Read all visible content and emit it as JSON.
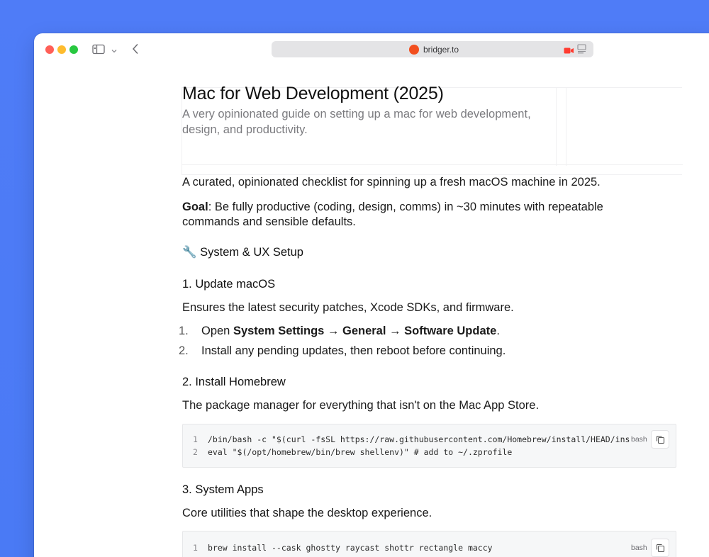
{
  "browser": {
    "url": "bridger.to",
    "favicon_color": "#f24e1e",
    "traffic_colors": [
      "#ff5f57",
      "#febc2e",
      "#28c840"
    ]
  },
  "header": {
    "title": "Mac for Web Development (2025)",
    "subtitle": "A very opinionated guide on setting up a mac for web development, design, and productivity."
  },
  "article": {
    "intro": "A curated, opinionated checklist for spinning up a fresh macOS machine in 2025.",
    "goal_label": "Goal",
    "goal_text": ": Be fully productive (coding, design, comms) in ~30 minutes with repeatable commands and sensible defaults.",
    "section_heading": "🔧 System & UX Setup",
    "steps": [
      {
        "heading": "1. Update macOS",
        "description": "Ensures the latest security patches, Xcode SDKs, and firmware.",
        "list": [
          {
            "num": "1.",
            "prefix": "Open ",
            "b1": "System Settings",
            "a1": " → ",
            "b2": "General",
            "a2": " → ",
            "b3": "Software Update",
            "suffix": "."
          },
          {
            "num": "2.",
            "text": "Install any pending updates, then reboot before continuing."
          }
        ]
      },
      {
        "heading": "2. Install Homebrew",
        "description": "The package manager for everything that isn't on the Mac App Store.",
        "code": {
          "language": "bash",
          "lines": [
            {
              "n": "1",
              "text": "/bin/bash -c \"$(curl -fsSL https://raw.githubusercontent.com/Homebrew/install/HEAD/install.sh)\""
            },
            {
              "n": "2",
              "text": "eval \"$(/opt/homebrew/bin/brew shellenv)\"   # add to ~/.zprofile"
            }
          ]
        }
      },
      {
        "heading": "3. System Apps",
        "description": "Core utilities that shape the desktop experience.",
        "code": {
          "language": "bash",
          "lines": [
            {
              "n": "1",
              "text": "brew install --cask ghostty raycast shottr rectangle maccy"
            }
          ]
        }
      }
    ]
  }
}
